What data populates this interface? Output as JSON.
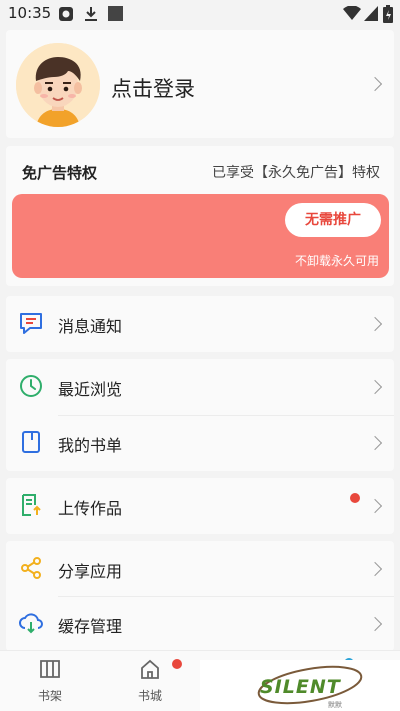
{
  "status_bar": {
    "time": "10:35"
  },
  "profile": {
    "login_label": "点击登录"
  },
  "ad_card": {
    "title": "免广告特权",
    "note": "已享受【永久免广告】特权",
    "button_label": "无需推广",
    "subtitle": "不卸载永久可用"
  },
  "menu": {
    "messages": "消息通知",
    "recent": "最近浏览",
    "booklist": "我的书单",
    "upload": "上传作品",
    "share": "分享应用",
    "cache": "缓存管理"
  },
  "tabbar": {
    "bookshelf": "书架",
    "bookstore": "书城"
  },
  "watermark": {
    "text": "SILENT",
    "sub": "默默"
  },
  "colors": {
    "accent_red": "#e8473c",
    "banner": "#f97f77",
    "icon_blue": "#2f6fe0",
    "icon_green": "#2fae6b",
    "icon_yellow": "#f2b01e"
  }
}
